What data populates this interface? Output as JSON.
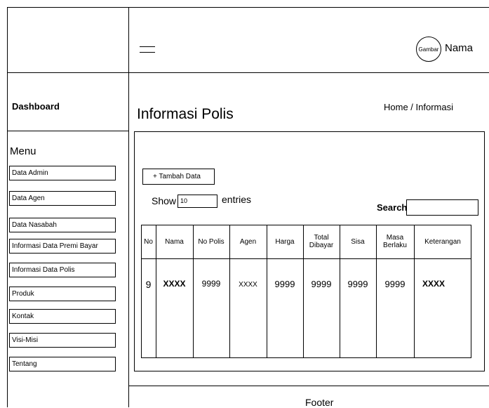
{
  "header": {
    "avatar_label": "Gambar",
    "user_name": "Nama"
  },
  "sidebar": {
    "title": "Dashboard",
    "menu_heading": "Menu",
    "items": [
      {
        "label": "Data Admin"
      },
      {
        "label": "Data Agen"
      },
      {
        "label": "Data Nasabah"
      },
      {
        "label": "Informasi Data Premi Bayar"
      },
      {
        "label": "Informasi Data Polis"
      },
      {
        "label": "Produk"
      },
      {
        "label": "Kontak"
      },
      {
        "label": "Visi-Misi"
      },
      {
        "label": "Tentang"
      }
    ]
  },
  "main": {
    "page_title": "Informasi Polis",
    "breadcrumb": "Home / Informasi",
    "add_button": "+ Tambah Data",
    "show_label": "Show",
    "entries_value": "10",
    "entries_label": "entries",
    "search_label": "Search:",
    "search_value": ""
  },
  "table": {
    "columns": [
      "No",
      "Nama",
      "No Polis",
      "Agen",
      "Harga",
      "Total Dibayar",
      "Sisa",
      "Masa Berlaku",
      "Keterangan"
    ],
    "rows": [
      [
        "9",
        "XXXX",
        "9999",
        "XXXX",
        "9999",
        "9999",
        "9999",
        "9999",
        "XXXX"
      ]
    ]
  },
  "footer": {
    "text": "Footer"
  }
}
